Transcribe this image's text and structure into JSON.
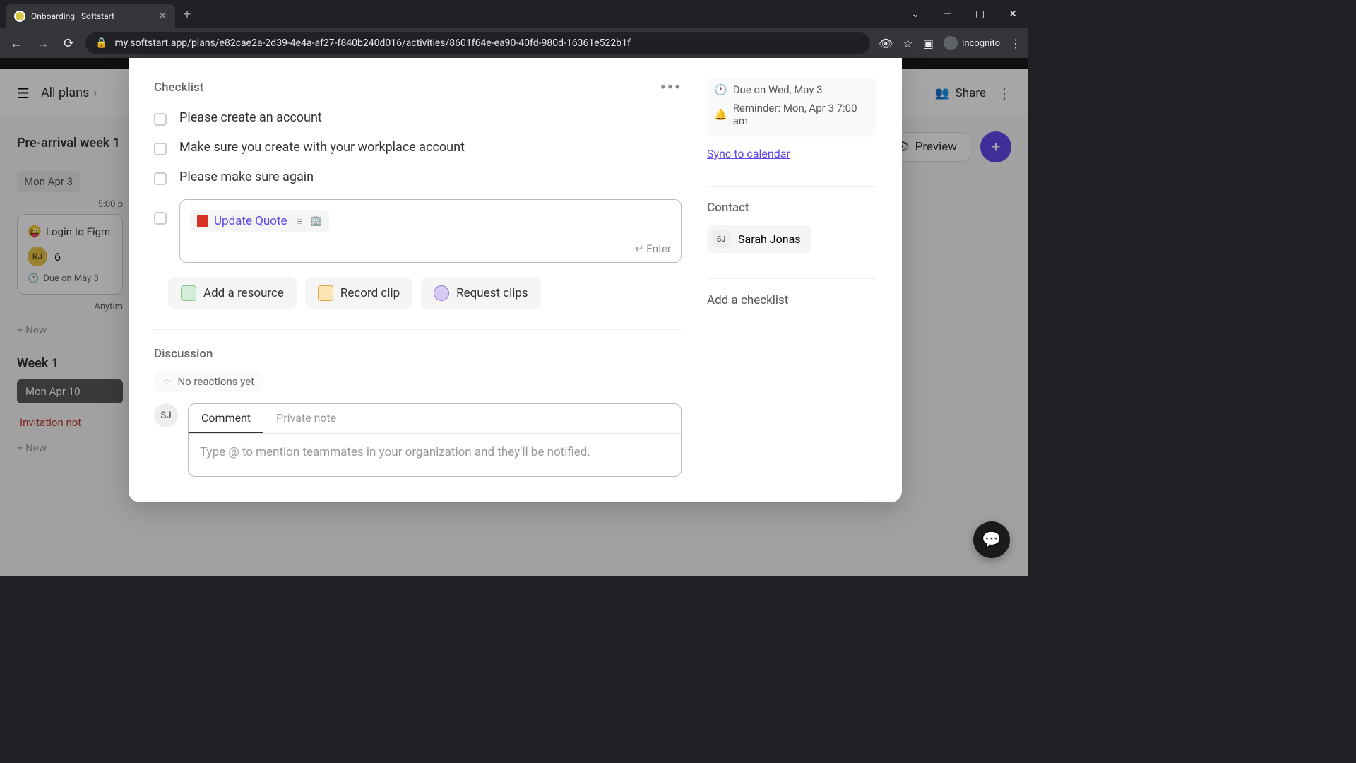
{
  "browser": {
    "tab_title": "Onboarding | Softstart",
    "url": "my.softstart.app/plans/e82cae2a-2d39-4e4a-af27-f840b240d016/activities/8601f64e-ea90-40fd-980d-16361e522b1f",
    "incognito_label": "Incognito"
  },
  "header": {
    "breadcrumb": "All plans",
    "share": "Share",
    "preview": "Preview"
  },
  "plan": {
    "section1": "Pre-arrival week 1",
    "day1": "Mon  Apr 3",
    "time1": "5:00 p",
    "card1_title": "Login to Figm",
    "card1_emoji": "😜",
    "card1_avatar": "RJ",
    "card1_count": "6",
    "card1_due": "Due on May 3",
    "anytime": "Anytim",
    "new": "New",
    "section2": "Week 1",
    "day2": "Mon  Apr 10",
    "invitation": "Invitation not"
  },
  "modal": {
    "checklist_label": "Checklist",
    "items": [
      "Please create an account",
      "Make sure you create with your workplace account",
      "Please make sure again"
    ],
    "resource_name": "Update Quote",
    "enter_hint": "↵ Enter",
    "actions": {
      "add_resource": "Add a resource",
      "record_clip": "Record clip",
      "request_clips": "Request clips"
    },
    "discussion_label": "Discussion",
    "no_reactions": "No reactions yet",
    "comment_tab": "Comment",
    "private_tab": "Private note",
    "comment_placeholder": "Type @ to mention teammates in your organization and they'll be notified.",
    "user_initials": "SJ"
  },
  "side": {
    "due": "Due on Wed, May 3",
    "reminder": "Reminder: Mon, Apr 3 7:00 am",
    "sync": "Sync to calendar",
    "contact_label": "Contact",
    "contact_initials": "SJ",
    "contact_name": "Sarah Jonas",
    "add_checklist": "Add a checklist"
  }
}
